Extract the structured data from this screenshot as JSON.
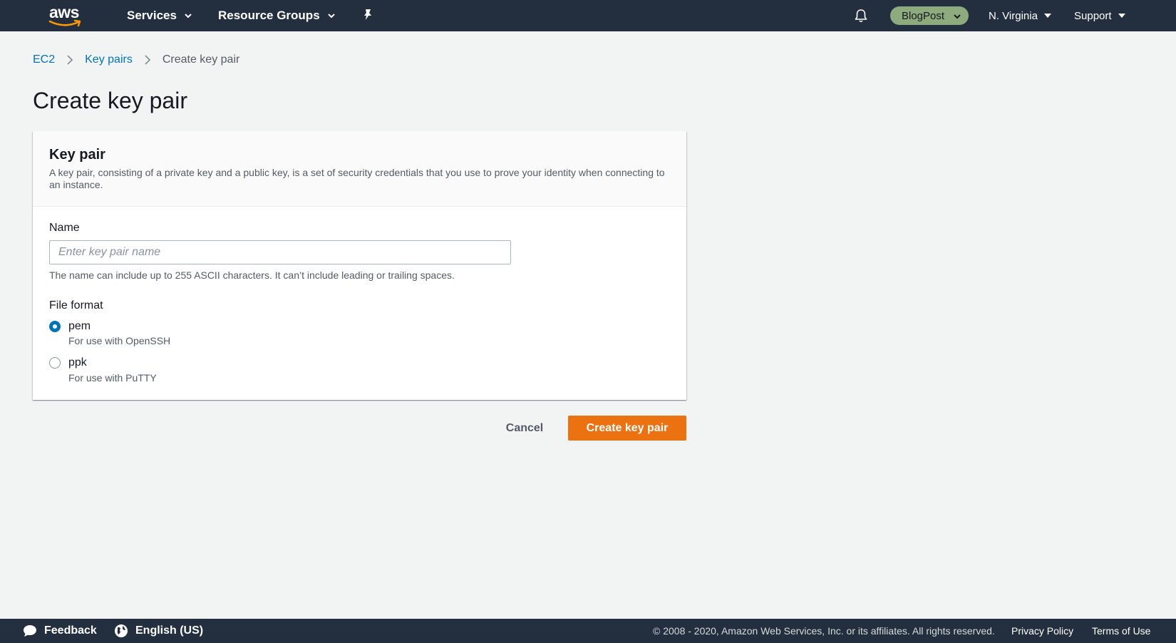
{
  "topnav": {
    "logo_text": "aws",
    "services_label": "Services",
    "resource_groups_label": "Resource Groups",
    "account_label": "BlogPost",
    "region_label": "N. Virginia",
    "support_label": "Support"
  },
  "breadcrumb": {
    "items": [
      "EC2",
      "Key pairs",
      "Create key pair"
    ]
  },
  "page_title": "Create key pair",
  "panel": {
    "title": "Key pair",
    "description": "A key pair, consisting of a private key and a public key, is a set of security credentials that you use to prove your identity when connecting to an instance.",
    "name_label": "Name",
    "name_value": "",
    "name_placeholder": "Enter key pair name",
    "name_hint": "The name can include up to 255 ASCII characters. It can’t include leading or trailing spaces.",
    "file_format_label": "File format",
    "options": [
      {
        "label": "pem",
        "description": "For use with OpenSSH",
        "selected": true
      },
      {
        "label": "ppk",
        "description": "For use with PuTTY",
        "selected": false
      }
    ]
  },
  "actions": {
    "cancel_label": "Cancel",
    "create_label": "Create key pair"
  },
  "footer": {
    "feedback_label": "Feedback",
    "language_label": "English (US)",
    "copyright": "© 2008 - 2020, Amazon Web Services, Inc. or its affiliates. All rights reserved.",
    "privacy_label": "Privacy Policy",
    "terms_label": "Terms of Use"
  },
  "colors": {
    "nav_bg": "#232f3e",
    "link": "#0073bb",
    "primary": "#ec7211",
    "account_pill": "#8eab7e"
  }
}
